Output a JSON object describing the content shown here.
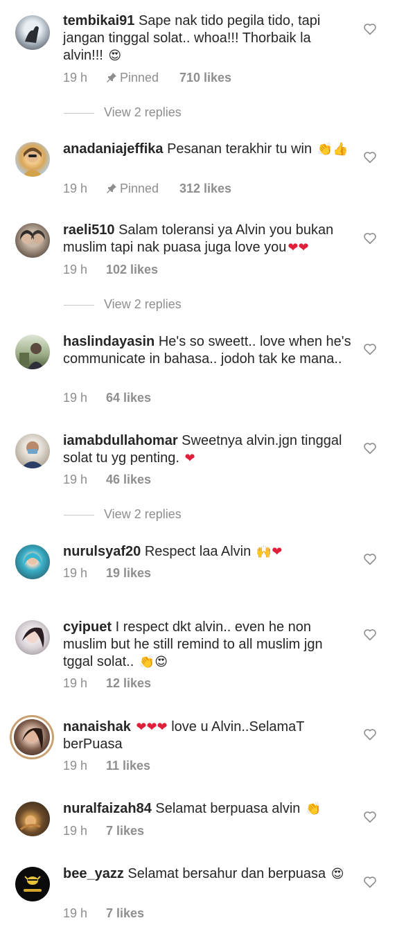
{
  "comments": [
    {
      "username": "tembikai91",
      "text": "Sape nak tido pegila tido, tapi jangan tinggal solat.. whoa!!! Thorbaik la alvin!!!",
      "emoji": "😍",
      "time": "19 h",
      "pinned": "Pinned",
      "likes": "710 likes",
      "replies": "View 2 replies"
    },
    {
      "username": "anadaniajeffika",
      "text": "Pesanan terakhir tu win",
      "emoji": "👏👍",
      "time": "19 h",
      "pinned": "Pinned",
      "likes": "312 likes"
    },
    {
      "username": "raeli510",
      "text": "Salam toleransi ya Alvin you bukan muslim tapi nak puasa juga love you",
      "emoji": "❤❤",
      "time": "19 h",
      "likes": "102 likes",
      "replies": "View 2 replies"
    },
    {
      "username": "haslindayasin",
      "text": "He's so sweett.. love when he's communicate in bahasa.. jodoh tak ke mana..",
      "time": "19 h",
      "likes": "64 likes"
    },
    {
      "username": "iamabdullahomar",
      "text": "Sweetnya alvin.jgn tinggal solat tu yg penting.",
      "emoji": "❤",
      "time": "19 h",
      "likes": "46 likes",
      "replies": "View 2 replies"
    },
    {
      "username": "nurulsyaf20",
      "text": "Respect laa Alvin",
      "emoji": "🙌❤",
      "time": "19 h",
      "likes": "19 likes"
    },
    {
      "username": "cyipuet",
      "text": "I respect dkt alvin.. even he non muslim but he still remind to all muslim jgn tggal solat..",
      "emoji": "👏😍",
      "time": "19 h",
      "likes": "12 likes"
    },
    {
      "username": "nanaishak",
      "emoji_before": "❤❤❤",
      "text": "love u Alvin..SelamaT berPuasa",
      "time": "19 h",
      "likes": "11 likes"
    },
    {
      "username": "nuralfaizah84",
      "text": "Selamat berpuasa alvin",
      "emoji": "👏",
      "time": "19 h",
      "likes": "7 likes"
    },
    {
      "username": "bee_yazz",
      "text": "Selamat bersahur dan berpuasa",
      "emoji": "😍",
      "time": "19 h",
      "likes": "7 likes"
    }
  ],
  "icons": {
    "like": "heart-outline-icon",
    "pin": "pin-icon"
  },
  "colors": {
    "text": "#262626",
    "meta": "#8e8e8e",
    "heart_emoji": "#e0203a"
  }
}
